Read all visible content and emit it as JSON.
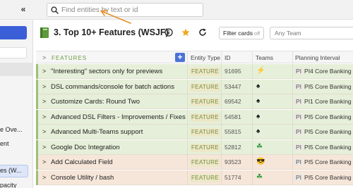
{
  "search": {
    "placeholder": "Find entities by text or id"
  },
  "header": {
    "title": "3. Top 10+ Features (WSJF)",
    "filter_label": "Filter cards",
    "filter_state": "off",
    "team_placeholder": "Any Team"
  },
  "sidebar": {
    "items": [
      "e Ove...",
      "ent",
      "es (W...",
      "pacity"
    ]
  },
  "table": {
    "columns": [
      "FEATURES",
      "Entity Type",
      "ID",
      "Teams",
      "Planning Interval"
    ],
    "rows": [
      {
        "name": "\"Interesting\" sectors only for previews",
        "type": "FEATURE",
        "id": "91695",
        "team_icon": "lightning-icon",
        "team_glyph": "⚡",
        "pi": "PI",
        "interval": "PI4 Core Banking",
        "bg": "#e6efd9"
      },
      {
        "name": "DSL commands/console for batch actions",
        "type": "FEATURE",
        "id": "53447",
        "team_icon": "spade-icon",
        "team_glyph": "♠",
        "pi": "PI",
        "interval": "PI5 Core Banking",
        "bg": "#e6efd9"
      },
      {
        "name": "Customize Cards: Round Two",
        "type": "FEATURE",
        "id": "69542",
        "team_icon": "spade-icon",
        "team_glyph": "♠",
        "pi": "PI",
        "interval": "PI1 Core Banking",
        "bg": "#e6efd9"
      },
      {
        "name": "Advanced DSL Filters - Improvements / Fixes",
        "type": "FEATURE",
        "id": "54581",
        "team_icon": "spade-icon",
        "team_glyph": "♠",
        "pi": "PI",
        "interval": "PI5 Core Banking",
        "bg": "#e6efd9"
      },
      {
        "name": "Advanced Multi-Teams support",
        "type": "FEATURE",
        "id": "55815",
        "team_icon": "spade-icon",
        "team_glyph": "♠",
        "pi": "PI",
        "interval": "PI5 Core Banking",
        "bg": "#e6efd9"
      },
      {
        "name": "Google Doc Integration",
        "type": "FEATURE",
        "id": "52812",
        "team_icon": "clover-icon",
        "team_glyph": "☘",
        "pi": "PI",
        "interval": "PI5 Core Banking",
        "bg": "#e6efd9"
      },
      {
        "name": "Add Calculated Field",
        "type": "FEATURE",
        "id": "93523",
        "team_icon": "sunglasses-icon",
        "team_glyph": "😎",
        "pi": "PI",
        "interval": "PI5 Core Banking",
        "bg": "#f6e6d9"
      },
      {
        "name": "Console Utility / bash",
        "type": "FEATURE",
        "id": "51774",
        "team_icon": "clover-icon",
        "team_glyph": "☘",
        "pi": "PI",
        "interval": "PI5 Core Banking",
        "bg": "#f6e6d9"
      }
    ]
  },
  "colors": {
    "accent": "#3b5fd6",
    "feature_text": "#6a9b3c",
    "star": "#f0a81c",
    "annotation_arrow": "#e8922a"
  }
}
